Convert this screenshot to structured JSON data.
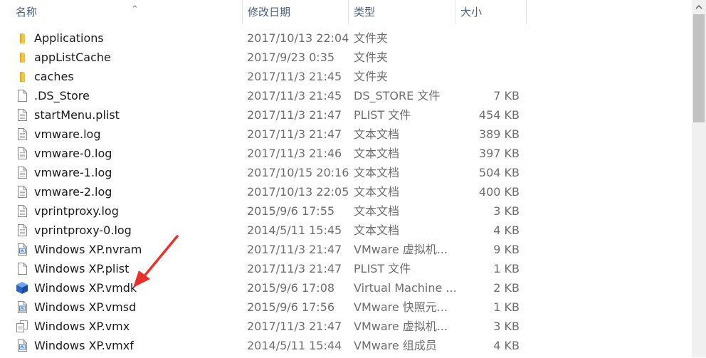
{
  "columns": {
    "name": "名称",
    "modified": "修改日期",
    "type": "类型",
    "size": "大小"
  },
  "files": [
    {
      "name": "Applications",
      "modified": "2017/10/13 22:04",
      "type": "文件夹",
      "size": "",
      "icon": "folder-icon"
    },
    {
      "name": "appListCache",
      "modified": "2017/9/23 0:35",
      "type": "文件夹",
      "size": "",
      "icon": "folder-icon"
    },
    {
      "name": "caches",
      "modified": "2017/11/3 21:45",
      "type": "文件夹",
      "size": "",
      "icon": "folder-icon"
    },
    {
      "name": ".DS_Store",
      "modified": "2017/11/3 21:45",
      "type": "DS_STORE 文件",
      "size": "7 KB",
      "icon": "blank-file-icon"
    },
    {
      "name": "startMenu.plist",
      "modified": "2017/11/3 21:47",
      "type": "PLIST 文件",
      "size": "454 KB",
      "icon": "text-file-icon"
    },
    {
      "name": "vmware.log",
      "modified": "2017/11/3 21:47",
      "type": "文本文档",
      "size": "389 KB",
      "icon": "text-file-icon"
    },
    {
      "name": "vmware-0.log",
      "modified": "2017/11/3 21:46",
      "type": "文本文档",
      "size": "397 KB",
      "icon": "text-file-icon"
    },
    {
      "name": "vmware-1.log",
      "modified": "2017/10/15 20:16",
      "type": "文本文档",
      "size": "504 KB",
      "icon": "text-file-icon"
    },
    {
      "name": "vmware-2.log",
      "modified": "2017/10/13 22:05",
      "type": "文本文档",
      "size": "400 KB",
      "icon": "text-file-icon"
    },
    {
      "name": "vprintproxy.log",
      "modified": "2015/9/6 17:55",
      "type": "文本文档",
      "size": "3 KB",
      "icon": "text-file-icon"
    },
    {
      "name": "vprintproxy-0.log",
      "modified": "2014/5/11 15:45",
      "type": "文本文档",
      "size": "4 KB",
      "icon": "text-file-icon"
    },
    {
      "name": "Windows XP.nvram",
      "modified": "2017/11/3 21:47",
      "type": "VMware 虚拟机...",
      "size": "9 KB",
      "icon": "vmware-file-icon"
    },
    {
      "name": "Windows XP.plist",
      "modified": "2017/11/3 21:47",
      "type": "PLIST 文件",
      "size": "1 KB",
      "icon": "blank-file-icon"
    },
    {
      "name": "Windows XP.vmdk",
      "modified": "2015/9/6 17:08",
      "type": "Virtual Machine ...",
      "size": "2 KB",
      "icon": "vmdk-cube-icon"
    },
    {
      "name": "Windows XP.vmsd",
      "modified": "2015/9/6 17:56",
      "type": "VMware 快照元...",
      "size": "1 KB",
      "icon": "vmware-file-icon"
    },
    {
      "name": "Windows XP.vmx",
      "modified": "2017/11/3 21:47",
      "type": "VMware 虚拟机...",
      "size": "3 KB",
      "icon": "vmx-file-icon"
    },
    {
      "name": "Windows XP.vmxf",
      "modified": "2014/5/11 15:44",
      "type": "VMware 组成员",
      "size": "4 KB",
      "icon": "vmware-file-icon"
    }
  ],
  "colors": {
    "header_text": "#4c607a",
    "annotation_arrow": "#e8312a",
    "folder": "#f0c54d",
    "vmdk_cube": "#2a64c8"
  }
}
